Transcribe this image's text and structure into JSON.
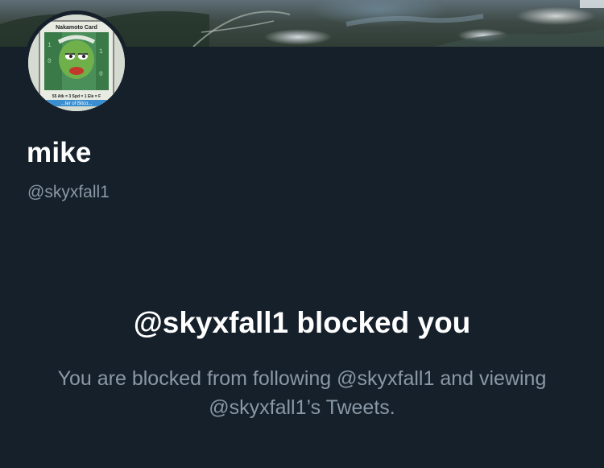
{
  "profile": {
    "display_name": "mike",
    "handle": "@skyxfall1",
    "avatar": {
      "card_title": "Nakamoto Card",
      "card_stats": "55  Atk = 3  Spd = 1  Ele = F",
      "card_caption": "...ter of Bitco..."
    }
  },
  "blocked": {
    "title": "@skyxfall1 blocked you",
    "description": "You are blocked from following @skyxfall1 and viewing @skyxfall1’s Tweets."
  },
  "colors": {
    "background": "#15202b",
    "primary_text": "#ffffff",
    "secondary_text": "#8b98a5"
  }
}
